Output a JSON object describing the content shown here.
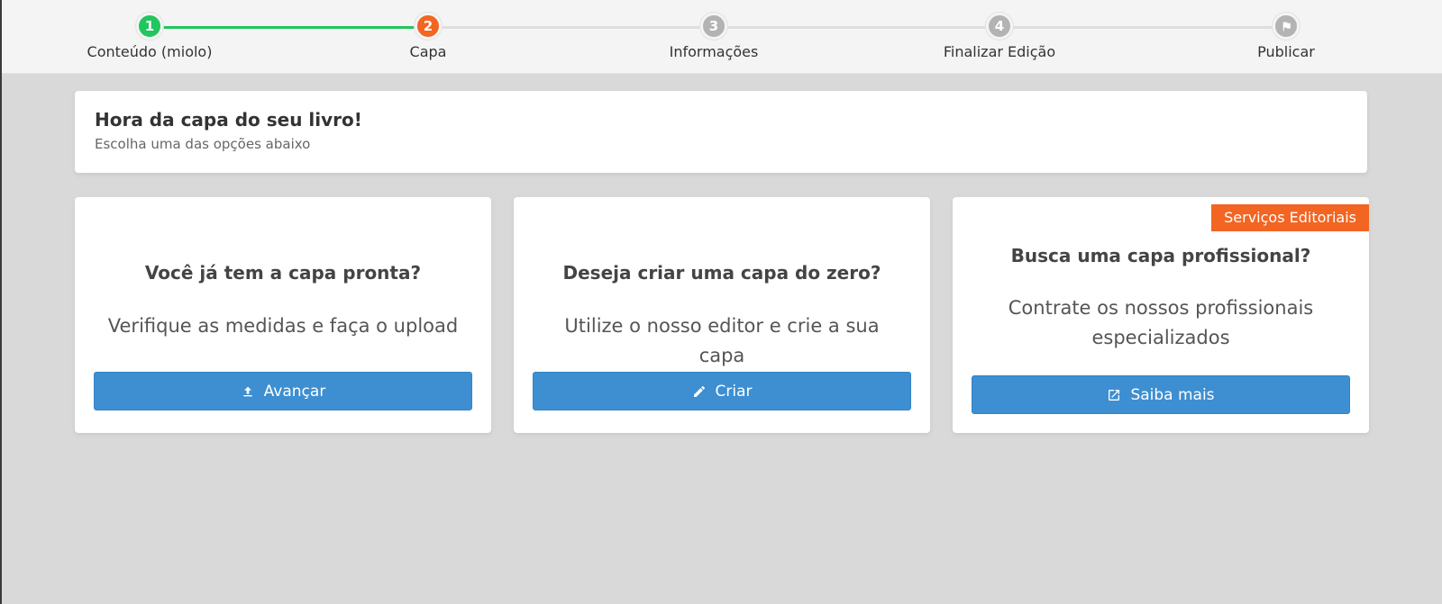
{
  "stepper": {
    "steps": [
      {
        "number": "1",
        "label": "Conteúdo (miolo)",
        "state": "completed"
      },
      {
        "number": "2",
        "label": "Capa",
        "state": "current"
      },
      {
        "number": "3",
        "label": "Informações",
        "state": "pending"
      },
      {
        "number": "4",
        "label": "Finalizar Edição",
        "state": "pending"
      },
      {
        "number": "",
        "label": "Publicar",
        "state": "pending",
        "icon": "flag-icon"
      }
    ]
  },
  "header": {
    "title": "Hora da capa do seu livro!",
    "subtitle": "Escolha uma das opções abaixo"
  },
  "options": [
    {
      "title": "Você já tem a capa pronta?",
      "description": "Verifique as medidas e faça o upload",
      "button_label": "Avançar",
      "button_icon": "upload-icon"
    },
    {
      "title": "Deseja criar uma capa do zero?",
      "description": "Utilize o nosso editor e crie a sua capa",
      "button_label": "Criar",
      "button_icon": "pencil-icon"
    },
    {
      "title": "Busca uma capa profissional?",
      "description": "Contrate os nossos profissionais especializados",
      "button_label": "Saiba mais",
      "button_icon": "external-link-icon",
      "badge": "Serviços Editoriais"
    }
  ],
  "colors": {
    "completed": "#22c55e",
    "current": "#f26522",
    "pending": "#b3b3b3",
    "button": "#3d8fd1",
    "badge": "#f26522",
    "background": "#d9d9d9"
  }
}
